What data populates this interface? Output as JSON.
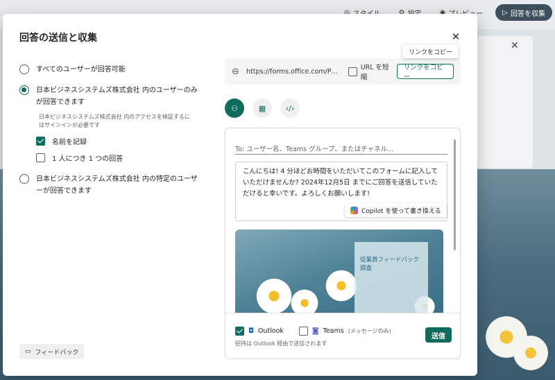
{
  "toolbar": {
    "style": "スタイル",
    "settings": "設定",
    "preview": "プレビュー",
    "collect": "回答を収集"
  },
  "dialog": {
    "title": "回答の送信と収集",
    "options": [
      {
        "label": "すべてのユーザーが回答可能",
        "checked": false
      },
      {
        "label": "日本ビジネスシステムズ株式会社 内のユーザーのみが回答できます",
        "checked": true
      },
      {
        "label": "日本ビジネスシステムズ株式会社 内の特定のユーザーが回答できます",
        "checked": false
      }
    ],
    "option_note": "日本ビジネスシステムズ株式会社 内のアクセスを検証するにはサインインが必要です",
    "record_name": "名前を記録",
    "one_response": "1 人につき 1 つの回答",
    "feedback": "フィードバック"
  },
  "link": {
    "url": "https://forms.office.com/Pages/ResponsePage.aspx",
    "shorten": "URL を短縮",
    "copy_button": "リンクをコピー",
    "tooltip": "リンクをコピー"
  },
  "email": {
    "to_placeholder": "To: ユーザー名、Teams グループ、またはチャネル...",
    "message": "こんにちは! 4 分ほどお時間をいただいてこのフォームに記入していただけませんか? 2024年12月5日 までにご回答を送信していただけると幸いです。よろしくお願いします!",
    "copilot": "Copilot を使って書き換える",
    "preview_title": "従業員フィードバック調査",
    "outlook": "Outlook",
    "teams": "Teams",
    "teams_note": "(メッセージのみ)",
    "hint": "招待は Outlook 経由で送信されます",
    "send": "送信"
  },
  "colors": {
    "accent": "#0f6c5d"
  }
}
